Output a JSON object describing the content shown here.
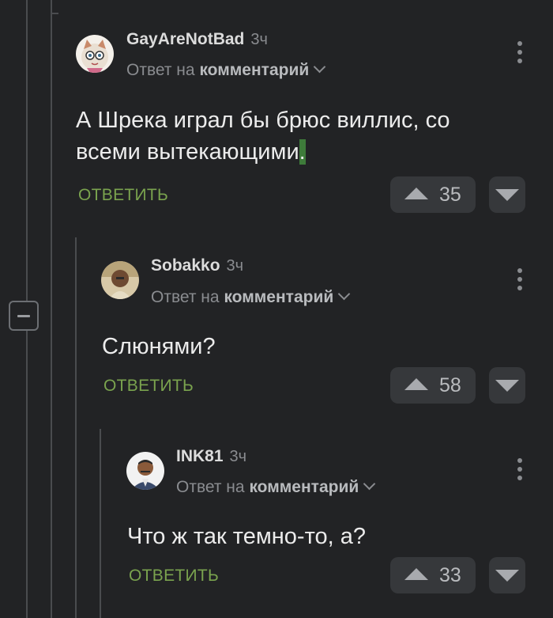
{
  "comments": [
    {
      "username": "GayAreNotBad",
      "time": "3ч",
      "reply_prefix": "Ответ на",
      "reply_link": "комментарий",
      "text": "А Шрека играл бы брюс виллис, со всеми вытекающими",
      "text_tail": ".",
      "reply_label": "ОТВЕТИТЬ",
      "rating": "35"
    },
    {
      "username": "Sobakko",
      "time": "3ч",
      "reply_prefix": "Ответ на",
      "reply_link": "комментарий",
      "text": "Слюнями?",
      "reply_label": "ОТВЕТИТЬ",
      "rating": "58"
    },
    {
      "username": "INK81",
      "time": "3ч",
      "reply_prefix": "Ответ на",
      "reply_link": "комментарий",
      "text": "Что ж так темно-то, а?",
      "reply_label": "ОТВЕТИТЬ",
      "rating": "33"
    }
  ],
  "icons": {
    "collapse": "minus-box-icon",
    "menu": "more-vertical-icon",
    "upvote": "triangle-up-icon",
    "downvote": "triangle-down-icon",
    "expand": "chevron-down-icon"
  },
  "colors": {
    "background": "#222325",
    "reply_accent": "#7aa34e",
    "button_bg": "#36383b"
  }
}
